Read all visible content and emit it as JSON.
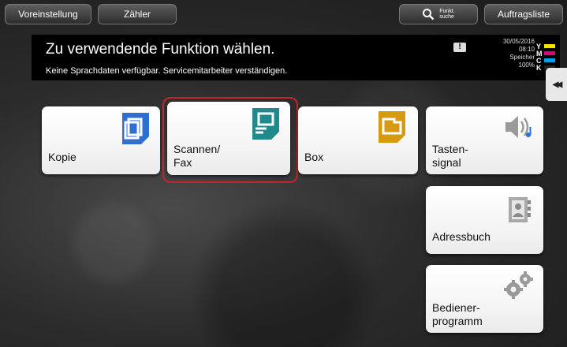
{
  "topbar": {
    "preset_label": "Voreinstellung",
    "counter_label": "Zähler",
    "search_label_line1": "Funkt.",
    "search_label_line2": "suche",
    "joblist_label": "Auftragsliste"
  },
  "header": {
    "title": "Zu verwendende Funktion wählen.",
    "message": "Keine Sprachdaten verfügbar. Servicemitarbeiter verständigen.",
    "warning_glyph": "!",
    "date": "30/05/2016",
    "time": "08:10",
    "memory_label": "Speicher",
    "memory_value": "100%",
    "toner": [
      {
        "letter": "Y",
        "color": "#f5e400"
      },
      {
        "letter": "M",
        "color": "#e4007f"
      },
      {
        "letter": "C",
        "color": "#00a0e9"
      },
      {
        "letter": "K",
        "color": "#222222"
      }
    ]
  },
  "side_tab_glyph": "◀◀",
  "tiles": {
    "copy": "Kopie",
    "scan_fax_line1": "Scannen/",
    "scan_fax_line2": "Fax",
    "box": "Box",
    "key_sound_line1": "Tasten-",
    "key_sound_line2": "signal",
    "address_book": "Adressbuch",
    "utility_line1": "Bediener-",
    "utility_line2": "programm"
  },
  "colors": {
    "selection": "#c0262c",
    "copy_icon": "#2f6fd1",
    "scan_icon": "#1e8a8c",
    "box_icon": "#d59a10"
  }
}
